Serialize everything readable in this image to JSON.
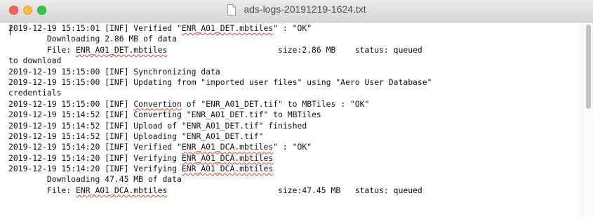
{
  "window": {
    "title": "ads-logs-20191219-1624.txt",
    "icon": "text-document-icon",
    "controls": [
      "close-button",
      "minimize-button",
      "zoom-button"
    ]
  },
  "log": {
    "lines": [
      [
        {
          "t": "2019-12-19 15:15:01 [INF] Verified \""
        },
        {
          "t": "ENR_A01_DET.mbtiles",
          "sp": true
        },
        {
          "t": "\" : \"OK\""
        }
      ],
      [
        {
          "t": "        Downloading 2.86 MB of data"
        }
      ],
      [
        {
          "t": "        File: "
        },
        {
          "t": "ENR_A01_DET.mbtiles",
          "sp": true
        },
        {
          "t": "                       size:2.86 MB    status: queued"
        }
      ],
      [
        {
          "t": "to download"
        }
      ],
      [
        {
          "t": "2019-12-19 15:15:00 [INF] Synchronizing data"
        }
      ],
      [
        {
          "t": "2019-12-19 15:15:00 [INF] Updating from \"imported user files\" using \"Aero User Database\""
        }
      ],
      [
        {
          "t": "credentials"
        }
      ],
      [
        {
          "t": "2019-12-19 15:15:00 [INF] "
        },
        {
          "t": "Convertion",
          "sp": true
        },
        {
          "t": " of \"ENR_A01_DET.tif\" to MBTiles : \"OK\""
        }
      ],
      [
        {
          "t": "2019-12-19 15:14:52 [INF] Converting \"ENR_A01_DET.tif\" to MBTiles"
        }
      ],
      [
        {
          "t": "2019-12-19 15:14:52 [INF] Upload of \"ENR_A01_DET.tif\" finished"
        }
      ],
      [
        {
          "t": "2019-12-19 15:14:52 [INF] Uploading \"ENR_A01_DET.tif\""
        }
      ],
      [
        {
          "t": "2019-12-19 15:14:20 [INF] Verified \""
        },
        {
          "t": "ENR_A01_DCA.mbtiles",
          "sp": true
        },
        {
          "t": "\" : \"OK\""
        }
      ],
      [
        {
          "t": "2019-12-19 15:14:20 [INF] Verifying "
        },
        {
          "t": "ENR_A01_DCA.mbtiles",
          "sp": true
        }
      ],
      [
        {
          "t": "2019-12-19 15:14:20 [INF] Verifying "
        },
        {
          "t": "ENR_A01_DCA.mbtiles",
          "sp": true
        }
      ],
      [
        {
          "t": "        Downloading 47.45 MB of data"
        }
      ],
      [
        {
          "t": "        File: "
        },
        {
          "t": "ENR_A01_DCA.mbtiles",
          "sp": true
        },
        {
          "t": "                       size:47.45 MB   status: queued"
        }
      ]
    ]
  }
}
